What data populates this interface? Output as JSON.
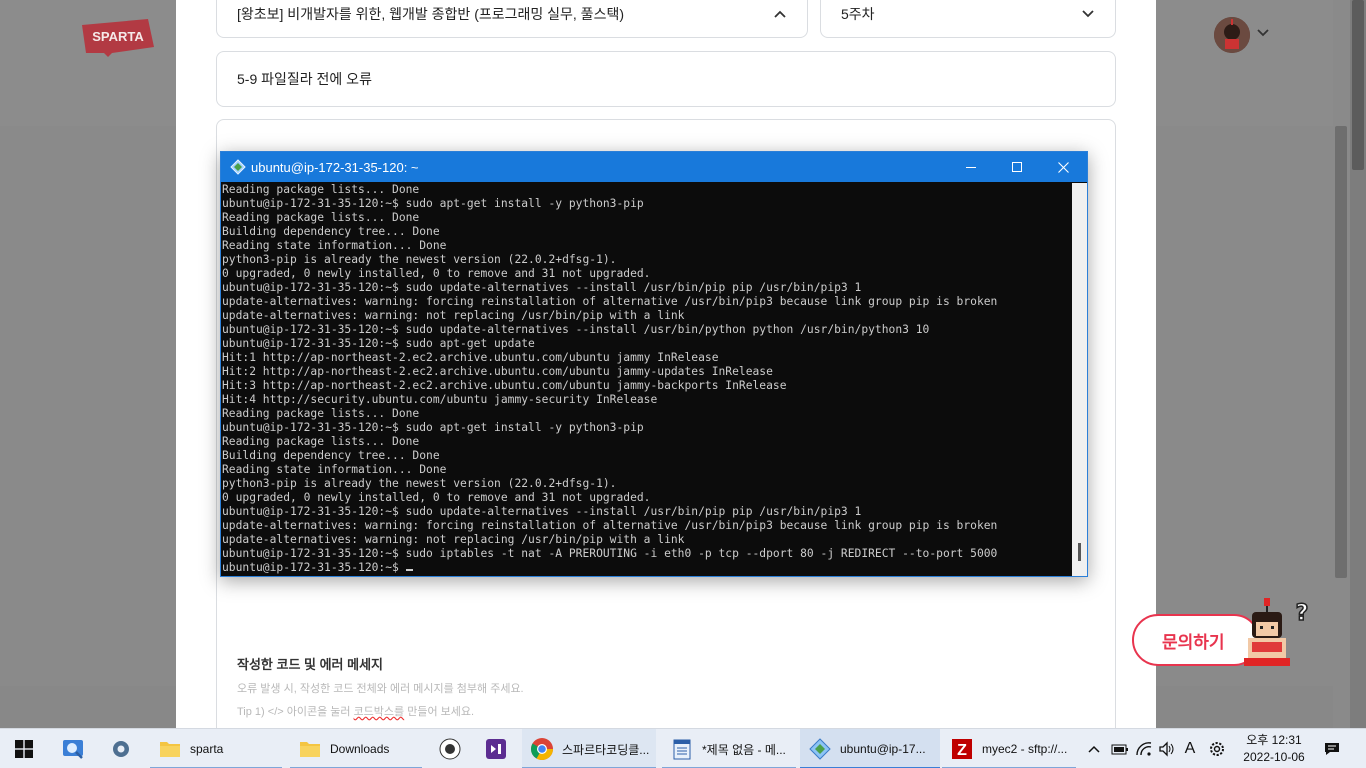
{
  "page": {
    "logo_text": "SPARTA",
    "course_select": "[왕초보] 비개발자를 위한, 웹개발 종합반 (프로그래밍 실무, 풀스택)",
    "week_select": "5주차",
    "question_title": "5-9 파일질라 전에 오류",
    "section_title": "작성한 코드 및 에러 메세지",
    "hint_1": "오류 발생 시, 작성한 코드 전체와 에러 메시지를 첨부해 주세요.",
    "hint_2_prefix": "Tip 1) </> 아이콘을 눌러 ",
    "hint_2_underlined": "코드박스를",
    "hint_2_suffix": " 만들어 보세요.",
    "ask_button": "문의하기"
  },
  "terminal": {
    "title": "ubuntu@ip-172-31-35-120: ~",
    "lines": [
      "Reading package lists... Done",
      "ubuntu@ip-172-31-35-120:~$ sudo apt-get install -y python3-pip",
      "Reading package lists... Done",
      "Building dependency tree... Done",
      "Reading state information... Done",
      "python3-pip is already the newest version (22.0.2+dfsg-1).",
      "0 upgraded, 0 newly installed, 0 to remove and 31 not upgraded.",
      "ubuntu@ip-172-31-35-120:~$ sudo update-alternatives --install /usr/bin/pip pip /usr/bin/pip3 1",
      "update-alternatives: warning: forcing reinstallation of alternative /usr/bin/pip3 because link group pip is broken",
      "update-alternatives: warning: not replacing /usr/bin/pip with a link",
      "ubuntu@ip-172-31-35-120:~$ sudo update-alternatives --install /usr/bin/python python /usr/bin/python3 10",
      "ubuntu@ip-172-31-35-120:~$ sudo apt-get update",
      "Hit:1 http://ap-northeast-2.ec2.archive.ubuntu.com/ubuntu jammy InRelease",
      "Hit:2 http://ap-northeast-2.ec2.archive.ubuntu.com/ubuntu jammy-updates InRelease",
      "Hit:3 http://ap-northeast-2.ec2.archive.ubuntu.com/ubuntu jammy-backports InRelease",
      "Hit:4 http://security.ubuntu.com/ubuntu jammy-security InRelease",
      "Reading package lists... Done",
      "ubuntu@ip-172-31-35-120:~$ sudo apt-get install -y python3-pip",
      "Reading package lists... Done",
      "Building dependency tree... Done",
      "Reading state information... Done",
      "python3-pip is already the newest version (22.0.2+dfsg-1).",
      "0 upgraded, 0 newly installed, 0 to remove and 31 not upgraded.",
      "ubuntu@ip-172-31-35-120:~$ sudo update-alternatives --install /usr/bin/pip pip /usr/bin/pip3 1",
      "update-alternatives: warning: forcing reinstallation of alternative /usr/bin/pip3 because link group pip is broken",
      "update-alternatives: warning: not replacing /usr/bin/pip with a link",
      "ubuntu@ip-172-31-35-120:~$ sudo iptables -t nat -A PREROUTING -i eth0 -p tcp --dport 80 -j REDIRECT --to-port 5000"
    ],
    "prompt": "ubuntu@ip-172-31-35-120:~$ ",
    "colors": {
      "titlebar": "#1879db",
      "background": "#0c0c0c",
      "text": "#cccccc"
    }
  },
  "taskbar": {
    "items": [
      {
        "label": "sparta",
        "icon": "folder-icon"
      },
      {
        "label": "Downloads",
        "icon": "folder-icon"
      },
      {
        "label": "스파르타코딩클...",
        "icon": "chrome-icon"
      },
      {
        "label": "*제목 없음 - 메...",
        "icon": "notepad-icon"
      },
      {
        "label": "ubuntu@ip-17...",
        "icon": "putty-icon"
      },
      {
        "label": "myec2 - sftp://...",
        "icon": "filezilla-icon"
      }
    ],
    "ime": "A",
    "clock_time": "오후 12:31",
    "clock_date": "2022-10-06"
  }
}
